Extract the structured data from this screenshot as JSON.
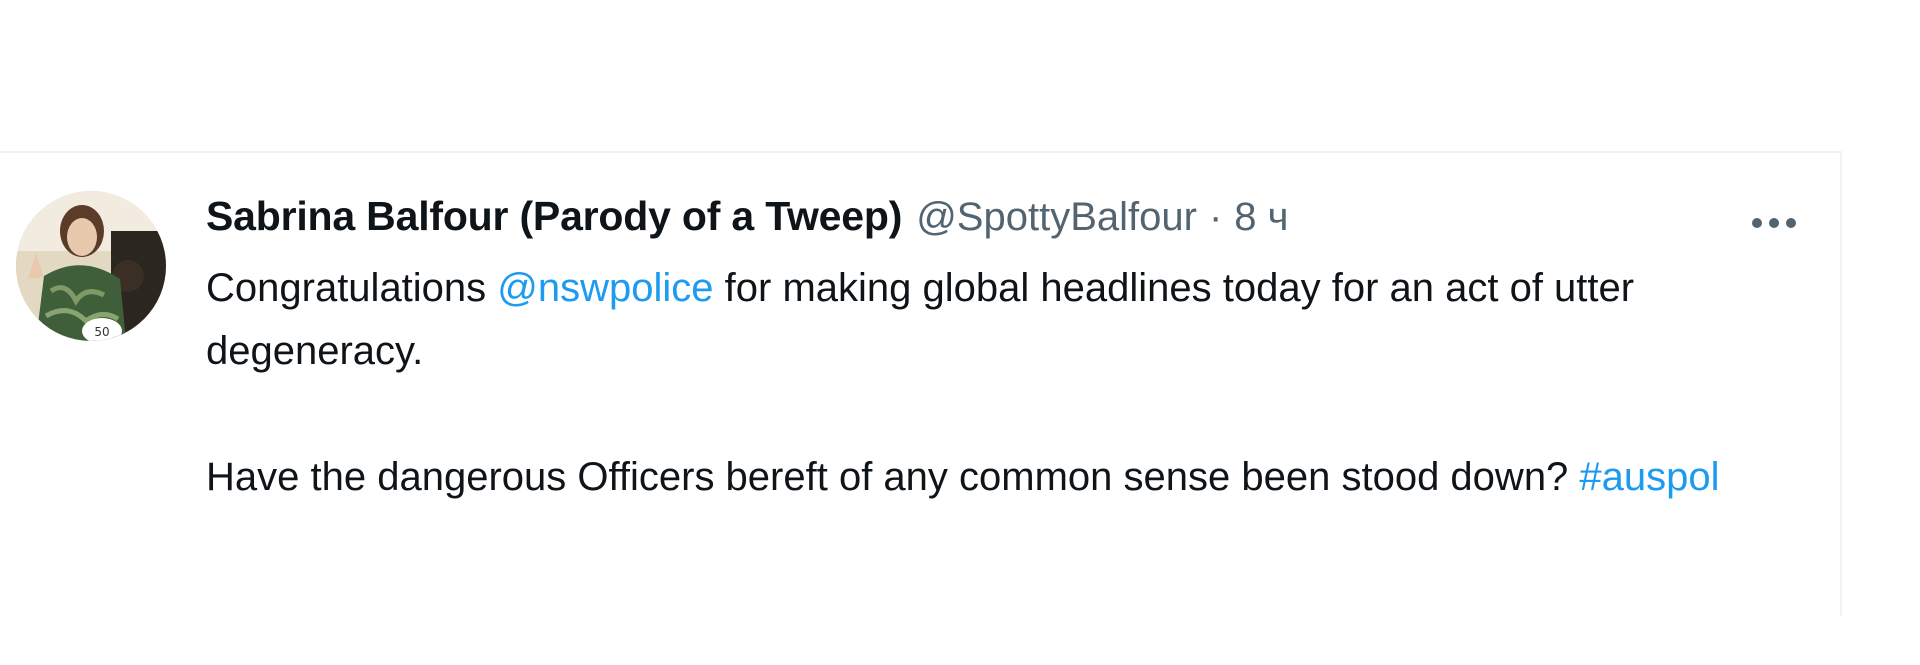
{
  "tweet": {
    "author": {
      "display_name": "Sabrina Balfour (Parody of a Tweep)",
      "handle": "@SpottyBalfour"
    },
    "separator": "·",
    "time": "8 ч",
    "more_icon": "more-horizontal-icon",
    "body": {
      "line1_prefix": "Congratulations ",
      "mention": "@nswpolice",
      "line1_suffix": " for making global headlines today for an act of utter degeneracy.",
      "line2_prefix": "Have the dangerous Officers bereft of any common sense been stood down? ",
      "hashtag": "#auspol"
    }
  },
  "colors": {
    "link": "#1d9bf0",
    "text": "#0f1419",
    "muted": "#536471",
    "border": "#eff3f4"
  }
}
